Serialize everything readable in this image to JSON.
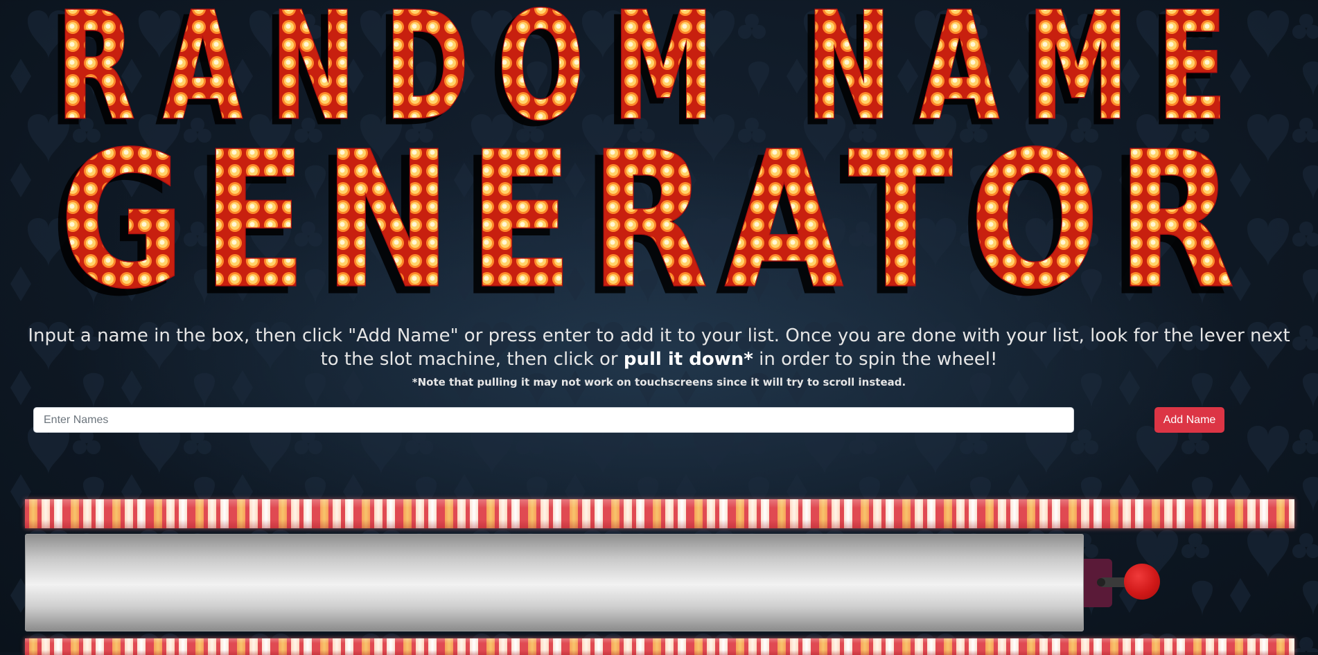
{
  "title": {
    "line1": "RANDOM NAME",
    "line2": "GENERATOR"
  },
  "instructions": {
    "part1": "Input a name in the box, then click \"Add Name\" or press enter to add it to your list. Once you are done with your list, look for the lever next to the slot machine, then click or ",
    "bold": "pull it down*",
    "part2": " in order to spin the wheel!",
    "note": "*Note that pulling it may not work on touchscreens since it will try to scroll instead."
  },
  "form": {
    "placeholder": "Enter Names",
    "value": "",
    "add_button_label": "Add Name"
  },
  "slot_machine": {
    "reel_text": "",
    "lever": "lever-knob"
  },
  "colors": {
    "accent": "#dc3545",
    "background": "#0b141f",
    "bulb_red": "#d92a1a",
    "bulb_glow": "#ffe07a",
    "lever_knob": "#d01818",
    "lever_housing": "#5a1a38"
  },
  "icons": {
    "background_pattern": "card-suits-pattern",
    "title_style": "marquee-bulb-letters"
  }
}
